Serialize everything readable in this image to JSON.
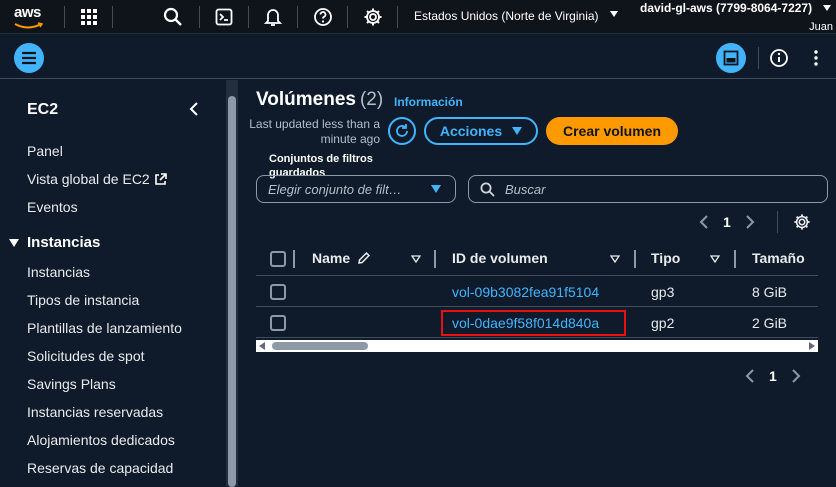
{
  "topnav": {
    "logo_text": "aws",
    "region": "Estados Unidos (Norte de Virginia)",
    "account": "david-gl-aws (7799-8064-7227)",
    "user": "Juan"
  },
  "sidebar": {
    "title": "EC2",
    "items": [
      "Panel",
      "Vista global de EC2",
      "Eventos"
    ],
    "section": "Instancias",
    "section_items": [
      "Instancias",
      "Tipos de instancia",
      "Plantillas de lanzamiento",
      "Solicitudes de spot",
      "Savings Plans",
      "Instancias reservadas",
      "Alojamientos dedicados",
      "Reservas de capacidad"
    ]
  },
  "main": {
    "title": "Volúmenes",
    "count": "(2)",
    "info_link": "Información",
    "last_updated": "Last updated less than a minute ago",
    "actions_label": "Acciones",
    "create_label": "Crear volumen",
    "filter_label": "Conjuntos de filtros guardados",
    "filter_placeholder": "Elegir conjunto de filt…",
    "search_placeholder": "Buscar",
    "page_number": "1"
  },
  "table": {
    "columns": [
      "Name",
      "ID de volumen",
      "Tipo",
      "Tamaño"
    ],
    "rows": [
      {
        "name": "",
        "volume_id": "vol-09b3082fea91f5104",
        "type": "gp3",
        "size": "8 GiB"
      },
      {
        "name": "",
        "volume_id": "vol-0dae9f58f014d840a",
        "type": "gp2",
        "size": "2 GiB"
      }
    ]
  },
  "footer_pager": {
    "page_number": "1"
  },
  "colors": {
    "accent": "#42b4ff",
    "primary_button": "#ff9900",
    "highlight": "#e81111",
    "background": "#0f1b2a"
  }
}
